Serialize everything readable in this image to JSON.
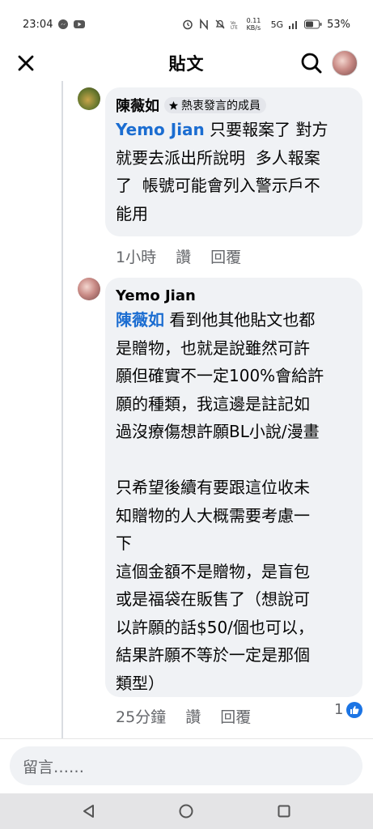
{
  "status_bar": {
    "time": "23:04",
    "network_speed": "0.11 KB/s",
    "network_type": "5G",
    "battery": "53%",
    "icons": [
      "messenger-icon",
      "youtube-icon",
      "alarm-icon",
      "nfc-icon",
      "mute-icon",
      "volte-icon",
      "signal-icon",
      "battery-icon"
    ]
  },
  "header": {
    "title": "貼文",
    "icons": [
      "close-icon",
      "search-icon",
      "profile-avatar"
    ]
  },
  "comments": [
    {
      "author": "陳薇如",
      "badge": "熱衷發言的成員",
      "mention": "Yemo Jian",
      "text": " 只要報案了 對方\n就要去派出所說明  多人報案\n了  帳號可能會列入警示戶不\n能用",
      "time": "1小時",
      "like_label": "讚",
      "reply_label": "回覆"
    },
    {
      "author": "Yemo Jian",
      "mention": "陳薇如",
      "text": " 看到他其他貼文也都\n是贈物，也就是說雖然可許\n願但確實不一定100%會給許\n願的種類，我這邊是註記如\n過沒療傷想許願BL小說/漫畫\n\n只希望後續有要跟這位收未\n知贈物的人大概需要考慮一\n下\n這個金額不是贈物，是盲包\n或是福袋在販售了（想說可\n以許願的話$50/個也可以，\n結果許願不等於一定是那個\n類型）",
      "time": "25分鐘",
      "like_label": "讚",
      "reply_label": "回覆",
      "reaction_count": "1"
    }
  ],
  "composer": {
    "placeholder": "留言……"
  },
  "nav_bar": {
    "icons": [
      "back-icon",
      "home-icon",
      "recents-icon"
    ]
  },
  "colors": {
    "mention": "#1b6dd1",
    "bubble": "#f0f2f5",
    "meta": "#65676b",
    "like": "#1b74e4"
  }
}
